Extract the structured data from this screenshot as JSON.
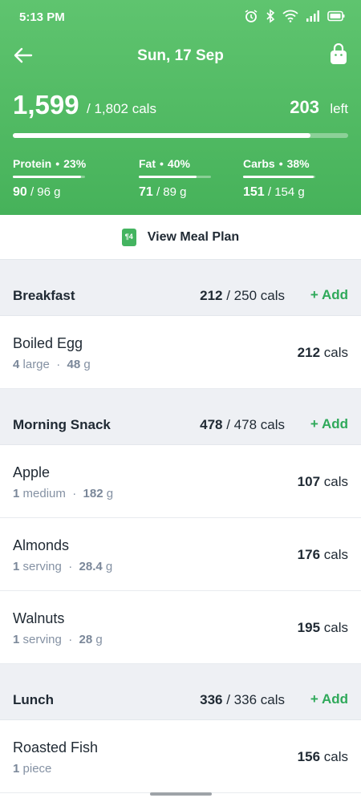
{
  "status": {
    "time": "5:13 PM",
    "icons": [
      "alarm-icon",
      "bluetooth-icon",
      "wifi-icon",
      "signal-icon",
      "battery-icon"
    ]
  },
  "header": {
    "date": "Sun, 17 Sep",
    "consumed": "1,599",
    "goal": "/ 1,802 cals",
    "left_value": "203",
    "left_label": "left",
    "progress_fraction": 0.887
  },
  "macros": [
    {
      "name": "Protein",
      "percent": "23%",
      "amount": "90",
      "target": "/ 96 g",
      "fill": 0.94
    },
    {
      "name": "Fat",
      "percent": "40%",
      "amount": "71",
      "target": "/ 89 g",
      "fill": 0.8
    },
    {
      "name": "Carbs",
      "percent": "38%",
      "amount": "151",
      "target": "/ 154 g",
      "fill": 0.98
    }
  ],
  "meal_plan": {
    "label": "View Meal Plan",
    "icon_text": "¶4"
  },
  "meals": [
    {
      "title": "Breakfast",
      "consumed": "212",
      "target": "/ 250 cals",
      "add_label": "+ Add",
      "items": [
        {
          "name": "Boiled Egg",
          "qty": "4",
          "unit": "large",
          "weight": "48",
          "weight_unit": "g",
          "cals": "212",
          "cals_unit": "cals"
        }
      ]
    },
    {
      "title": "Morning Snack",
      "consumed": "478",
      "target": "/ 478 cals",
      "add_label": "+ Add",
      "items": [
        {
          "name": "Apple",
          "qty": "1",
          "unit": "medium",
          "weight": "182",
          "weight_unit": "g",
          "cals": "107",
          "cals_unit": "cals"
        },
        {
          "name": "Almonds",
          "qty": "1",
          "unit": "serving",
          "weight": "28.4",
          "weight_unit": "g",
          "cals": "176",
          "cals_unit": "cals"
        },
        {
          "name": "Walnuts",
          "qty": "1",
          "unit": "serving",
          "weight": "28",
          "weight_unit": "g",
          "cals": "195",
          "cals_unit": "cals"
        }
      ]
    },
    {
      "title": "Lunch",
      "consumed": "336",
      "target": "/ 336 cals",
      "add_label": "+ Add",
      "items": [
        {
          "name": "Roasted Fish",
          "qty": "1",
          "unit": "piece",
          "weight": "",
          "weight_unit": "",
          "cals": "156",
          "cals_unit": "cals"
        }
      ]
    }
  ],
  "colors": {
    "header_green": "#4fb862",
    "accent_green": "#2fa95a",
    "section_bg": "#eef0f4"
  }
}
